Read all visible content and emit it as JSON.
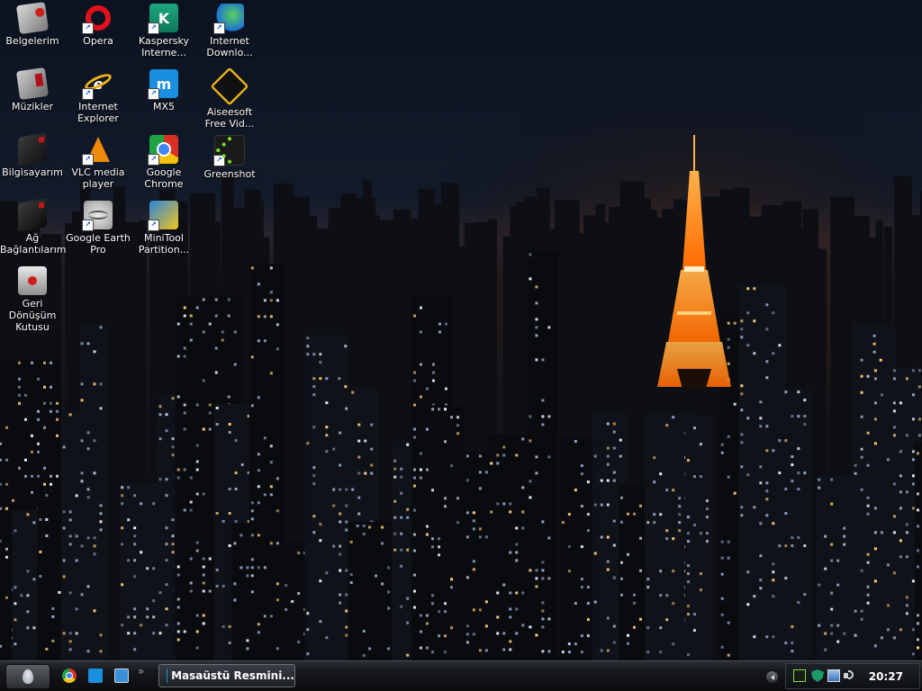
{
  "desktop": {
    "icons": [
      {
        "id": "belgelerim",
        "label": "Belgelerim",
        "icon": "documents-folder-icon"
      },
      {
        "id": "opera",
        "label": "Opera",
        "icon": "opera-icon"
      },
      {
        "id": "kaspersky",
        "label": "Kaspersky\nInterne...",
        "icon": "kaspersky-icon"
      },
      {
        "id": "idm",
        "label": "Internet\nDownlo...",
        "icon": "internet-download-manager-icon"
      },
      {
        "id": "muzikler",
        "label": "Müzikler",
        "icon": "music-folder-icon"
      },
      {
        "id": "ie",
        "label": "Internet\nExplorer",
        "icon": "internet-explorer-icon"
      },
      {
        "id": "mx5",
        "label": "MX5",
        "icon": "maxthon-icon"
      },
      {
        "id": "aiseesoft",
        "label": "Aiseesoft\nFree Vid...",
        "icon": "aiseesoft-icon"
      },
      {
        "id": "bilgisayarim",
        "label": "Bilgisayarım",
        "icon": "computer-icon"
      },
      {
        "id": "vlc",
        "label": "VLC media\nplayer",
        "icon": "vlc-icon"
      },
      {
        "id": "chrome",
        "label": "Google\nChrome",
        "icon": "chrome-icon"
      },
      {
        "id": "greenshot",
        "label": "Greenshot",
        "icon": "greenshot-icon"
      },
      {
        "id": "ag",
        "label": "Ağ\nBağlantılarım",
        "icon": "network-connections-icon"
      },
      {
        "id": "earth",
        "label": "Google Earth\nPro",
        "icon": "google-earth-icon"
      },
      {
        "id": "minitool",
        "label": "MiniTool\nPartition...",
        "icon": "minitool-icon"
      },
      {
        "id": "geridonusum",
        "label": "Geri Dönüşüm\nKutusu",
        "icon": "recycle-bin-icon"
      }
    ]
  },
  "taskbar": {
    "start": {
      "icon": "alien-start-icon"
    },
    "quick_launch": [
      {
        "id": "chrome",
        "icon": "chrome-icon"
      },
      {
        "id": "mx5",
        "icon": "maxthon-icon"
      },
      {
        "id": "show-desktop",
        "icon": "show-desktop-icon"
      }
    ],
    "more_glyph": "»",
    "active_task": {
      "label": "Masaüstü Resmini...",
      "icon": "maxthon-icon"
    },
    "tray": {
      "icons": [
        "greenshot-icon",
        "kaspersky-shield-icon",
        "network-icon",
        "volume-icon"
      ],
      "clock": "20:27"
    }
  },
  "colors": {
    "taskbar_bg": "#15171b",
    "label_text": "#ffffff",
    "tower_orange": "#ff8a1a",
    "sky": "#0b1220"
  }
}
